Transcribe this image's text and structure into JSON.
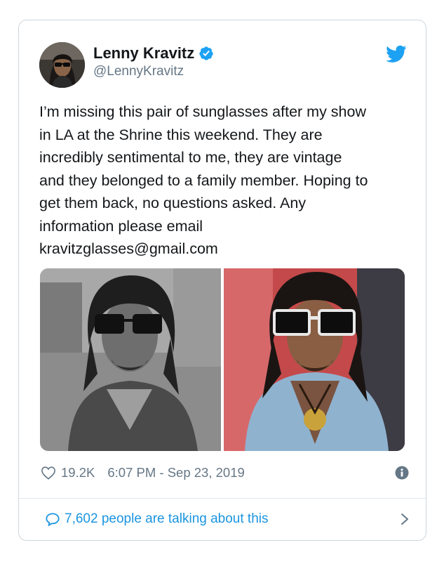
{
  "author": {
    "name": "Lenny Kravitz",
    "handle": "@LennyKravitz"
  },
  "tweet": {
    "text": "I’m missing this pair of sunglasses after my show\nin LA at the Shrine this weekend. They are\nincredibly sentimental to me, they are vintage\nand they belonged to a family member. Hoping to\nget them back, no questions asked. Any\ninformation please email\nkravitzglasses@gmail.com"
  },
  "stats": {
    "likes": "19.2K",
    "timestamp": "6:07 PM - Sep 23, 2019"
  },
  "conversation": {
    "label": "7,602 people are talking about this"
  },
  "colors": {
    "twitter_blue": "#1da1f2",
    "link_blue": "#1b95e0",
    "muted_text": "#657786",
    "border": "#cfd6dc"
  },
  "icons": [
    "verified-badge-icon",
    "twitter-bird-icon",
    "heart-icon",
    "info-icon",
    "speech-bubble-icon",
    "chevron-right-icon"
  ]
}
